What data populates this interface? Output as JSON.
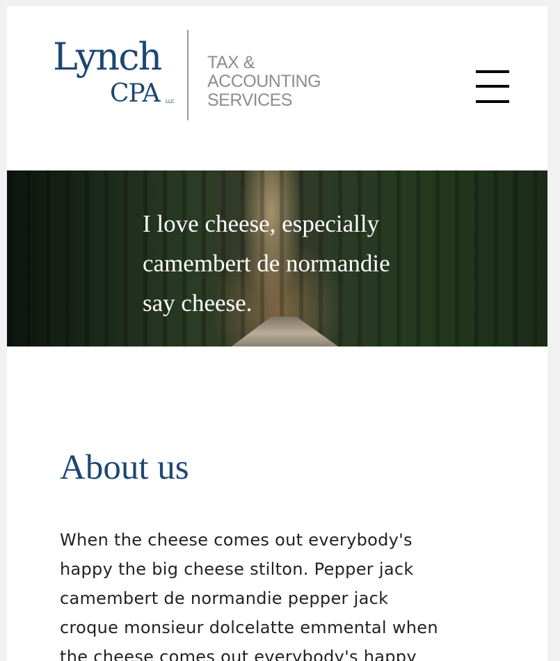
{
  "header": {
    "logo": {
      "name": "Lynch",
      "suffix": "CPA",
      "llc": "LLC",
      "tagline_lines": [
        "TAX &",
        "ACCOUNTING",
        "SERVICES"
      ]
    },
    "menu_icon": "hamburger-menu-icon"
  },
  "hero": {
    "lines": [
      "I love cheese, especially",
      "camembert de normandie",
      "say cheese."
    ]
  },
  "about": {
    "title": "About us",
    "body_lines": [
      "When the cheese comes out everybody's",
      "happy the big cheese stilton. Pepper jack",
      "camembert de normandie pepper jack",
      "croque monsieur dolcelatte emmental when",
      "the cheese comes out everybody's happy"
    ]
  },
  "colors": {
    "brand_blue": "#1d4773",
    "tagline_gray": "#8d8d8d",
    "body_text": "#222222"
  }
}
